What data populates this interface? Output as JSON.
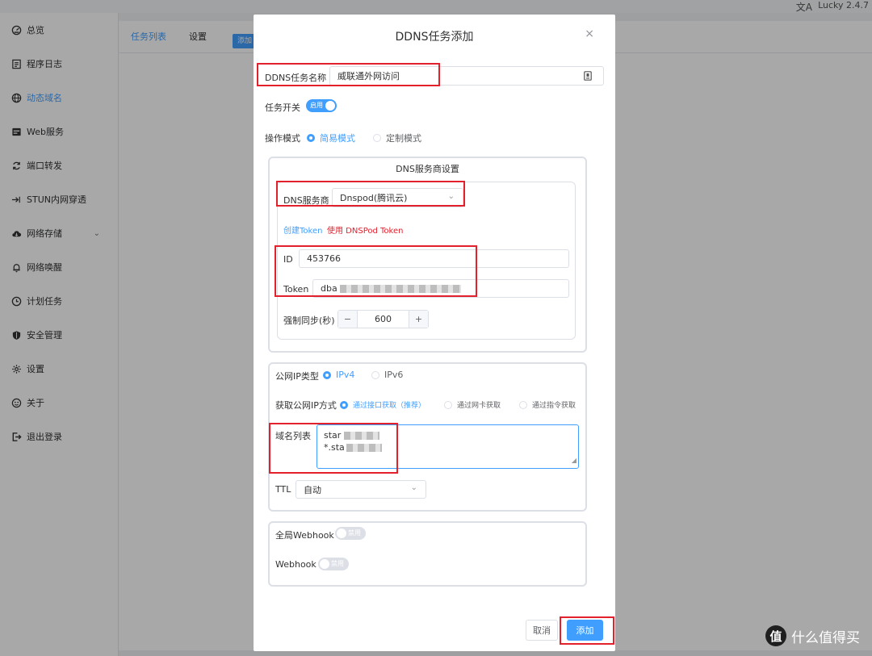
{
  "topbar": {
    "lang_glyph": "文A",
    "version": "Lucky 2.4.7"
  },
  "sidebar": {
    "items": [
      {
        "label": "总览",
        "icon": "dashboard-icon"
      },
      {
        "label": "程序日志",
        "icon": "log-icon"
      },
      {
        "label": "动态域名",
        "icon": "globe-icon",
        "active": true
      },
      {
        "label": "Web服务",
        "icon": "server-icon"
      },
      {
        "label": "端口转发",
        "icon": "forward-icon"
      },
      {
        "label": "STUN内网穿透",
        "icon": "stun-icon"
      },
      {
        "label": "网络存储",
        "icon": "cloud-icon"
      },
      {
        "label": "网络唤醒",
        "icon": "bell-icon"
      },
      {
        "label": "计划任务",
        "icon": "clock-icon"
      },
      {
        "label": "安全管理",
        "icon": "shield-icon"
      },
      {
        "label": "设置",
        "icon": "gear-icon"
      },
      {
        "label": "关于",
        "icon": "about-icon"
      },
      {
        "label": "退出登录",
        "icon": "logout-icon"
      }
    ]
  },
  "tabs": {
    "tab1": "任务列表",
    "tab2": "设置",
    "add": "添加"
  },
  "dialog": {
    "title": "DDNS任务添加",
    "close": "×",
    "task_name_label": "DDNS任务名称",
    "task_name_value": "威联通外网访问",
    "task_switch_label": "任务开关",
    "task_switch_text": "启用",
    "mode_label": "操作模式",
    "mode_simple": "简易模式",
    "mode_custom": "定制模式",
    "dns_section_title": "DNS服务商设置",
    "dns_provider_label": "DNS服务商",
    "dns_provider_value": "Dnspod(腾讯云)",
    "create_token_link": "创建Token",
    "use_token_link": "使用 DNSPod Token",
    "id_label": "ID",
    "id_value": "453766",
    "token_label": "Token",
    "token_value_prefix": "dba",
    "force_sync_label": "强制同步(秒)",
    "force_sync_value": "600",
    "stepper_minus": "−",
    "stepper_plus": "+",
    "ip_type_label": "公网IP类型",
    "ip_type_v4": "IPv4",
    "ip_type_v6": "IPv6",
    "get_ip_label": "获取公网IP方式",
    "get_ip_opt1": "通过接口获取（推荐）",
    "get_ip_opt2": "通过网卡获取",
    "get_ip_opt3": "通过指令获取",
    "domain_list_label": "域名列表",
    "domain_line1_prefix": "star",
    "domain_line2_prefix": "*.sta",
    "ttl_label": "TTL",
    "ttl_value": "自动",
    "global_webhook_label": "全局Webhook",
    "global_webhook_switch": "禁用",
    "webhook_label": "Webhook",
    "webhook_switch": "禁用",
    "cancel_button": "取消",
    "add_button": "添加"
  },
  "watermark": {
    "logo": "值",
    "text": "什么值得买"
  },
  "colors": {
    "accent": "#409eff",
    "annotation_red": "#e3212d"
  }
}
